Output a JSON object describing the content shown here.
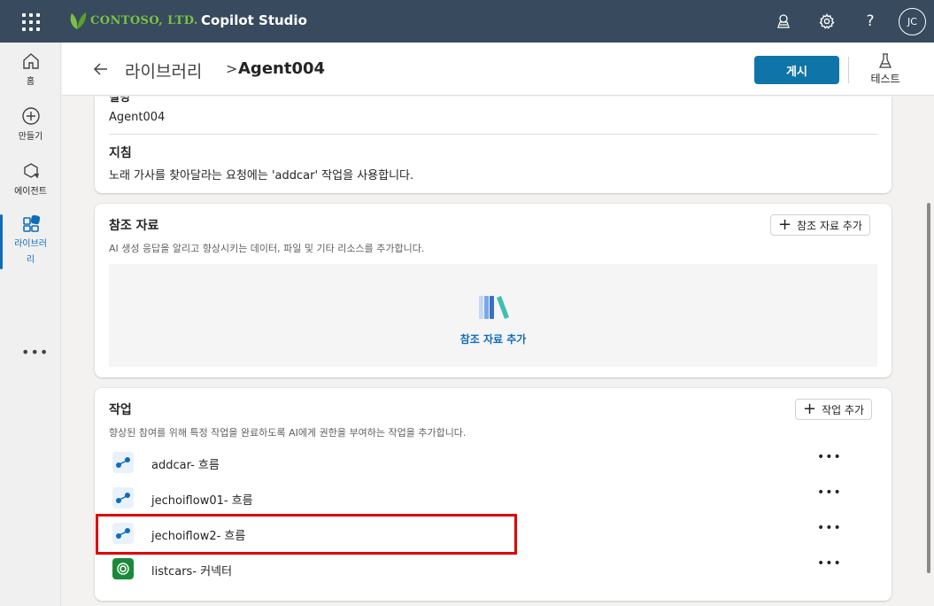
{
  "header": {
    "company": "CONTOSO, LTD.",
    "app_title": "Copilot Studio",
    "avatar_initials": "JC",
    "help_label": "?"
  },
  "rail": {
    "items": [
      {
        "label": "홈",
        "icon": "home-icon"
      },
      {
        "label": "만들기",
        "icon": "add-circle-icon"
      },
      {
        "label": "에이전트",
        "icon": "agent-icon"
      },
      {
        "label": "라이브러리",
        "icon": "library-icon"
      }
    ],
    "more_label": "•••"
  },
  "page": {
    "breadcrumb_parent": "라이브러리",
    "breadcrumb_sep": ">",
    "breadcrumb_current": "Agent004",
    "publish_label": "게시",
    "test_label": "테스트"
  },
  "details": {
    "name_label": "설명",
    "name_value": "Agent004",
    "instructions_label": "지침",
    "instructions_text": "노래 가사를 찾아달라는 요청에는 'addcar' 작업을 사용합니다."
  },
  "knowledge": {
    "title": "참조 자료",
    "add_button": "참조 자료 추가",
    "description": "AI 생성 응답을 알리고 향상시키는 데이터, 파일 및 기타 리소스를 추가합니다.",
    "empty_add_link": "참조 자료 추가"
  },
  "actions": {
    "title": "작업",
    "add_button": "작업 추가",
    "description": "향상된 참여를 위해 특정 작업을 완료하도록 AI에게 권한을 부여하는 작업을 추가합니다.",
    "items": [
      {
        "name": "addcar- 흐름",
        "type": "flow"
      },
      {
        "name": "jechoiflow01- 흐름",
        "type": "flow"
      },
      {
        "name": "jechoiflow2- 흐름",
        "type": "flow"
      },
      {
        "name": "listcars- 커넥터",
        "type": "connector"
      }
    ],
    "more_label": "•••"
  },
  "colors": {
    "header_bg": "#374a5e",
    "accent": "#0f6cbd",
    "publish_bg": "#0f75a8",
    "highlight": "#e00000"
  }
}
